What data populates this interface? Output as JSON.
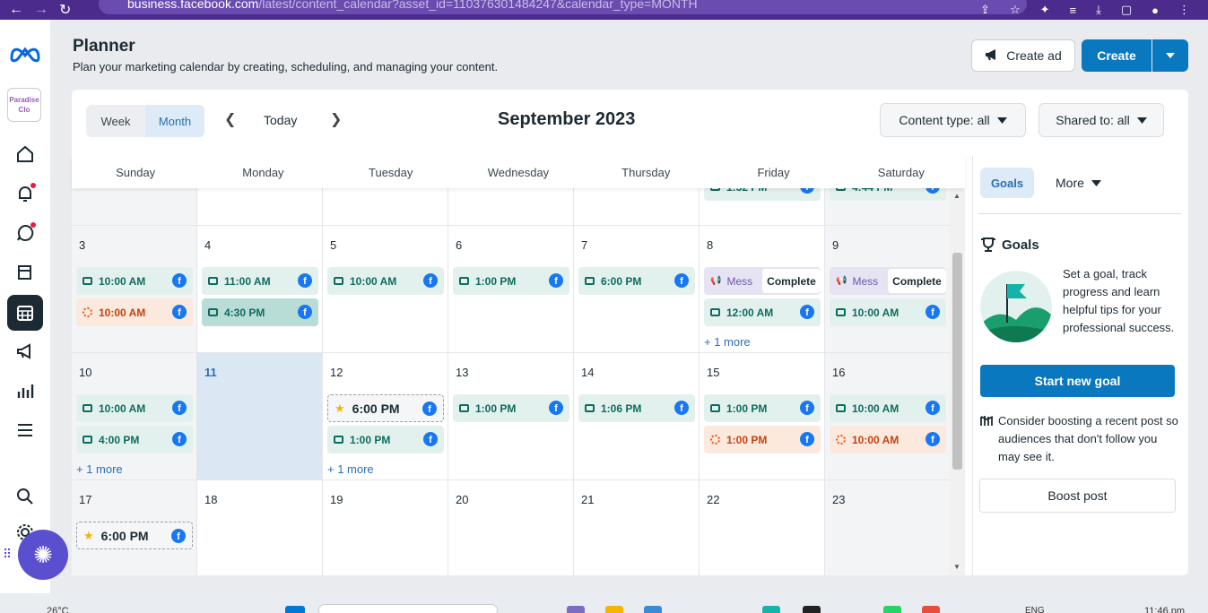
{
  "browser": {
    "url_host": "business.facebook.com",
    "url_path": "/latest/content_calendar?asset_id=110376301484247&calendar_type=MONTH"
  },
  "header": {
    "title": "Planner",
    "subtitle": "Plan your marketing calendar by creating, scheduling, and managing your content.",
    "create_ad_label": "Create ad",
    "create_label": "Create"
  },
  "sidebar": {
    "avatar_text": "Paradise Clo"
  },
  "toolbar": {
    "week_label": "Week",
    "month_label": "Month",
    "today_label": "Today",
    "month_title": "September 2023",
    "content_type_label": "Content type: all",
    "shared_to_label": "Shared to: all"
  },
  "calendar": {
    "days_of_week": [
      "Sunday",
      "Monday",
      "Tuesday",
      "Wednesday",
      "Thursday",
      "Friday",
      "Saturday"
    ],
    "top_partial": [
      {
        "col": 5,
        "time": "1:32 PM"
      },
      {
        "col": 6,
        "time": "4:44 PM"
      }
    ],
    "weeks": [
      {
        "days": [
          {
            "num": "3",
            "weekend": true,
            "events": [
              {
                "type": "green",
                "time": "10:00 AM"
              },
              {
                "type": "orange",
                "time": "10:00 AM"
              }
            ]
          },
          {
            "num": "4",
            "events": [
              {
                "type": "green",
                "time": "11:00 AM"
              },
              {
                "type": "green-dark",
                "time": "4:30 PM"
              }
            ]
          },
          {
            "num": "5",
            "events": [
              {
                "type": "green",
                "time": "10:00 AM"
              }
            ]
          },
          {
            "num": "6",
            "events": [
              {
                "type": "green",
                "time": "1:00 PM"
              }
            ]
          },
          {
            "num": "7",
            "events": [
              {
                "type": "green",
                "time": "6:00 PM"
              }
            ]
          },
          {
            "num": "8",
            "events": [
              {
                "type": "purple",
                "time": "Mess",
                "status": "Complete"
              },
              {
                "type": "green",
                "time": "12:00 AM"
              }
            ],
            "more": "+ 1 more"
          },
          {
            "num": "9",
            "weekend": true,
            "events": [
              {
                "type": "purple",
                "time": "Mess",
                "status": "Complete"
              },
              {
                "type": "green",
                "time": "10:00 AM"
              }
            ]
          }
        ]
      },
      {
        "days": [
          {
            "num": "10",
            "weekend": true,
            "events": [
              {
                "type": "green",
                "time": "10:00 AM"
              },
              {
                "type": "green",
                "time": "4:00 PM"
              }
            ],
            "more": "+ 1 more"
          },
          {
            "num": "11",
            "today": true,
            "events": []
          },
          {
            "num": "12",
            "events": [
              {
                "type": "dashed",
                "time": "6:00 PM"
              },
              {
                "type": "green",
                "time": "1:00 PM"
              }
            ],
            "more": "+ 1 more"
          },
          {
            "num": "13",
            "events": [
              {
                "type": "green",
                "time": "1:00 PM"
              }
            ]
          },
          {
            "num": "14",
            "events": [
              {
                "type": "green",
                "time": "1:06 PM"
              }
            ]
          },
          {
            "num": "15",
            "events": [
              {
                "type": "green",
                "time": "1:00 PM"
              },
              {
                "type": "orange",
                "time": "1:00 PM"
              }
            ]
          },
          {
            "num": "16",
            "weekend": true,
            "events": [
              {
                "type": "green",
                "time": "10:00 AM"
              },
              {
                "type": "orange",
                "time": "10:00 AM"
              }
            ]
          }
        ]
      },
      {
        "days": [
          {
            "num": "17",
            "weekend": true,
            "events": [
              {
                "type": "dashed",
                "time": "6:00 PM"
              }
            ]
          },
          {
            "num": "18",
            "events": []
          },
          {
            "num": "19",
            "events": []
          },
          {
            "num": "20",
            "events": []
          },
          {
            "num": "21",
            "events": []
          },
          {
            "num": "22",
            "events": []
          },
          {
            "num": "23",
            "weekend": true,
            "events": []
          }
        ]
      }
    ]
  },
  "panel": {
    "goals_tab": "Goals",
    "more_tab": "More",
    "goals_heading": "Goals",
    "goal_text": "Set a goal, track progress and learn helpful tips for your professional success.",
    "start_goal_label": "Start new goal",
    "boost_text": "Consider boosting a recent post so audiences that don't follow you may see it.",
    "boost_label": "Boost post"
  },
  "taskbar": {
    "temperature": "26°C",
    "language": "ENG",
    "time": "11:46 pm"
  },
  "colors": {
    "accent": "#0a78be",
    "rail_active": "#1c2b33",
    "green_event": "#e3f1ee",
    "orange_event": "#fbe9de",
    "purple_event": "#e6e3f3",
    "today_bg": "#dbe7f3"
  }
}
